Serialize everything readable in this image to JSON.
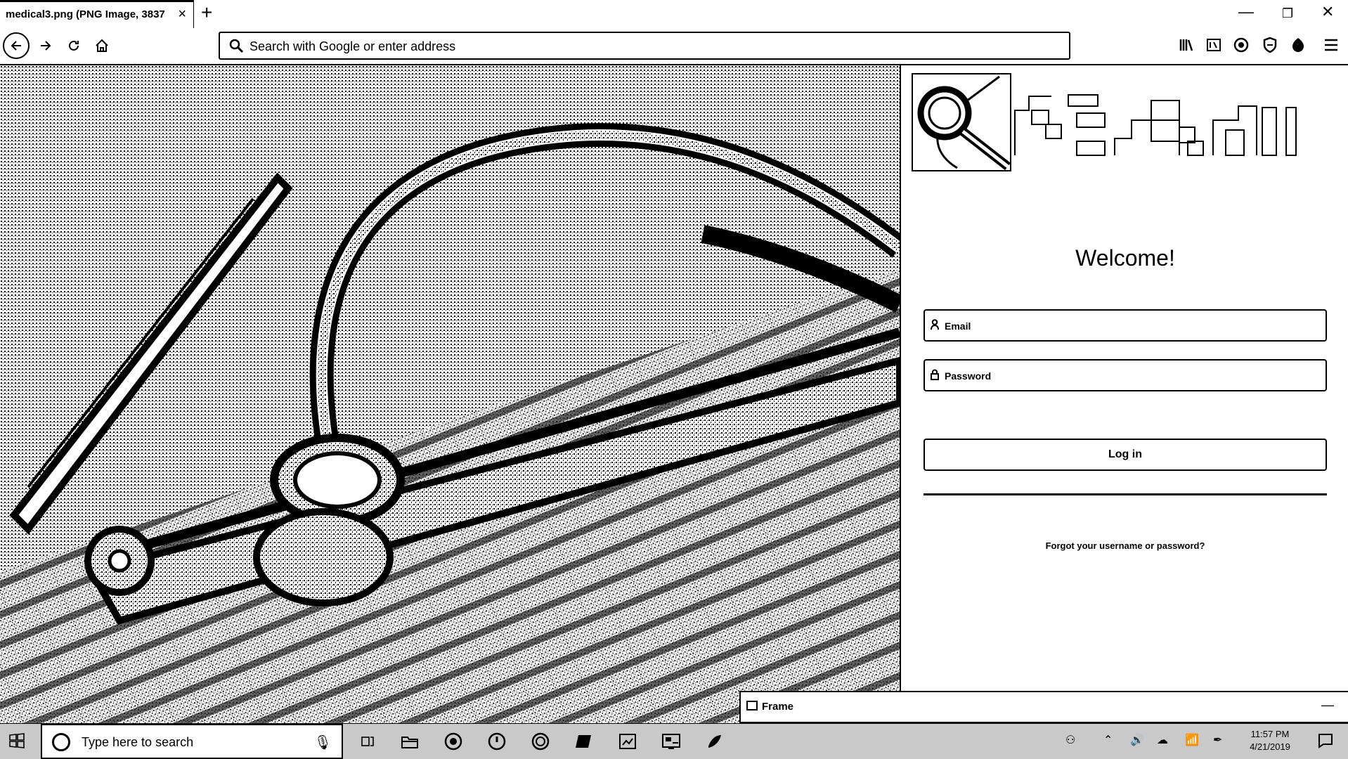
{
  "browser": {
    "tab_title": "medical3.png (PNG Image, 3837",
    "tab_close": "×",
    "new_tab": "+",
    "window_min": "—",
    "window_restore": "❐",
    "window_close": "✕",
    "url_placeholder": "Search with Google or enter address",
    "toolbar_icons": [
      "library-icon",
      "reader-icon",
      "extension-icon",
      "shield-icon",
      "extension-icon",
      "menu-icon"
    ]
  },
  "login": {
    "welcome": "Welcome!",
    "email_placeholder": "Email",
    "password_placeholder": "Password",
    "login_label": "Log in",
    "forgot_label": "Forgot your username or password?"
  },
  "frame_window": {
    "title": "Frame",
    "minimize": "—"
  },
  "taskbar": {
    "search_placeholder": "Type here to search",
    "apps": [
      "task-view-icon",
      "file-explorer-icon",
      "app-icon",
      "app-icon",
      "app-icon",
      "app-icon",
      "app-icon",
      "app-icon",
      "app-icon"
    ],
    "time": "11:57 PM",
    "date": "4/21/2019"
  },
  "colors": {
    "foreground": "#000000",
    "background": "#ffffff",
    "taskbar": "#c9c9c9"
  }
}
